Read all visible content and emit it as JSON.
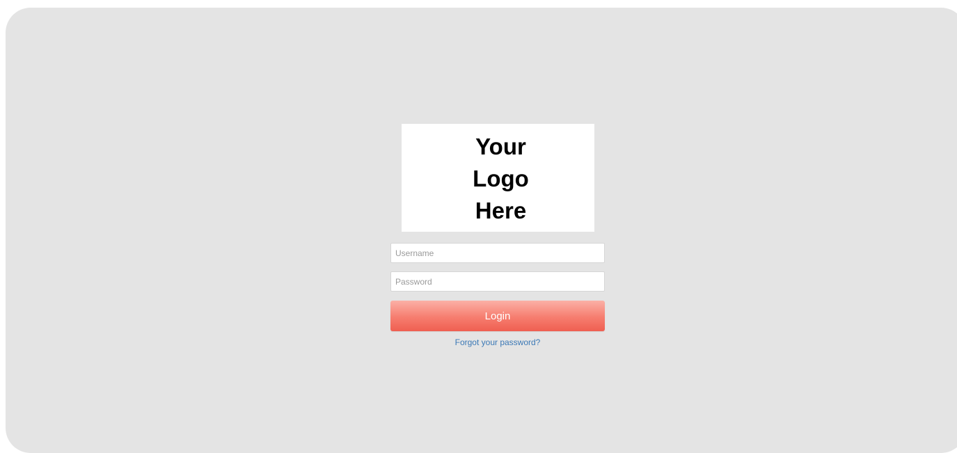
{
  "logo": {
    "lines": [
      "Your",
      "Logo",
      "Here"
    ]
  },
  "form": {
    "username_placeholder": "Username",
    "password_placeholder": "Password",
    "login_label": "Login",
    "forgot_label": "Forgot your password?"
  },
  "colors": {
    "background": "#e4e4e4",
    "button": "#f67d6f",
    "link": "#3c79b6"
  }
}
